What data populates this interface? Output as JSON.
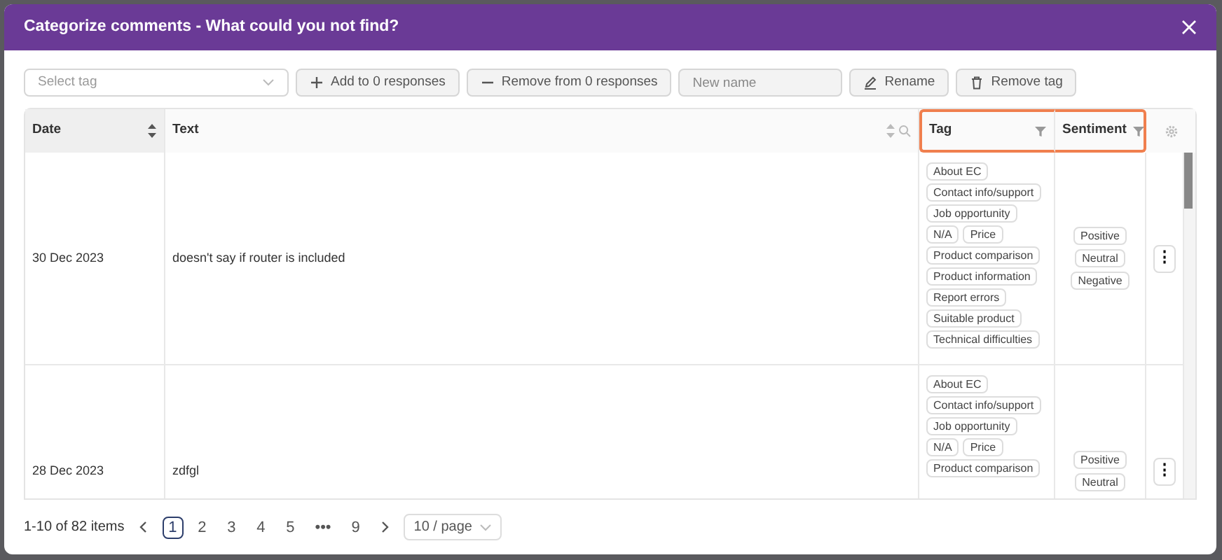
{
  "dialog": {
    "title": "Categorize comments - What could you not find?"
  },
  "toolbar": [
    {
      "kind": "select",
      "placeholder": "Select tag"
    },
    {
      "kind": "add",
      "label": "Add to 0 responses"
    },
    {
      "kind": "remove",
      "label": "Remove from 0 responses"
    },
    {
      "kind": "input",
      "placeholder": "New name"
    },
    {
      "kind": "rename",
      "label": "Rename"
    },
    {
      "kind": "delete",
      "label": "Remove tag"
    }
  ],
  "table": {
    "columns": [
      {
        "label": "Date",
        "sortable": true,
        "sorted": true,
        "searchable": false,
        "filterable": false,
        "highlighted": false
      },
      {
        "label": "Text",
        "sortable": true,
        "sorted": false,
        "searchable": true,
        "filterable": false,
        "highlighted": false
      },
      {
        "label": "Tag",
        "sortable": false,
        "sorted": false,
        "searchable": false,
        "filterable": true,
        "highlighted": true
      },
      {
        "label": "Sentiment",
        "sortable": false,
        "sorted": false,
        "searchable": false,
        "filterable": true,
        "highlighted": true
      }
    ],
    "rows": [
      {
        "date": "30 Dec 2023",
        "text": "doesn't say if router is included",
        "tags": [
          "About EC",
          "Contact info/support",
          "Job opportunity",
          "N/A",
          "Price",
          "Product comparison",
          "Product information",
          "Report errors",
          "Suitable product",
          "Technical difficulties"
        ],
        "sentiments": [
          "Positive",
          "Neutral",
          "Negative"
        ],
        "actions": "⋮"
      },
      {
        "date": "28 Dec 2023",
        "text": "zdfgl",
        "tags": [
          "About EC",
          "Contact info/support",
          "Job opportunity",
          "N/A",
          "Price",
          "Product comparison"
        ],
        "sentiments": [
          "Positive",
          "Neutral"
        ],
        "actions": "⋮"
      }
    ]
  },
  "pagination": {
    "summary": "1-10 of 82 items",
    "pages": [
      {
        "label": "1",
        "selected": true
      },
      {
        "label": "2",
        "selected": false
      },
      {
        "label": "3",
        "selected": false
      },
      {
        "label": "4",
        "selected": false
      },
      {
        "label": "5",
        "selected": false
      },
      {
        "label": "•••",
        "selected": false
      },
      {
        "label": "9",
        "selected": false
      }
    ],
    "page_size": "10 / page"
  }
}
